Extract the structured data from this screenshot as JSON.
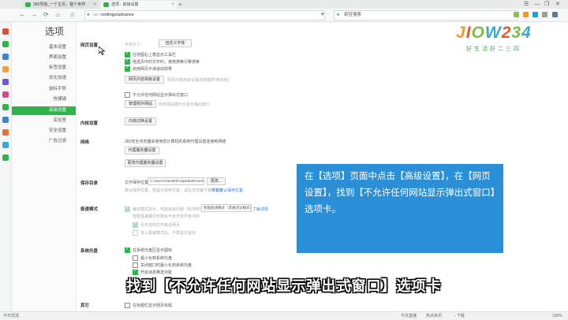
{
  "tabs": [
    {
      "label": "360导航_一个主页，整个世界",
      "icon_color": "#2fb34a"
    },
    {
      "label": "选项 - 高级设置",
      "icon_color": "#2fb34a"
    }
  ],
  "new_tab_label": "+",
  "window_controls": [
    "☰",
    "—",
    "❐",
    "✕"
  ],
  "nav": {
    "back": "←",
    "forward": "→",
    "refresh": "⟳",
    "home": "⌂",
    "star": "☆",
    "address_host": "se://",
    "address_path": "settings/advance",
    "search_text": "疯狂搜索",
    "search_logo": "e"
  },
  "left_strip_icon_colors": [
    "#e24a3a",
    "#2fb34a",
    "#3a86d6",
    "#f0a23a",
    "#6b5bd6",
    "#d64a8a",
    "#2fb34a",
    "#3a86d6",
    "#e2743a",
    "#3aa8d6",
    "#2fb34a"
  ],
  "settings_nav": {
    "title": "选项",
    "items": [
      "基本设置",
      "界面设置",
      "标签设置",
      "优化加速",
      "鼠标手势",
      "快捷键",
      "高级设置",
      "实验室",
      "安全设置",
      "广告过滤"
    ],
    "active_index": 6
  },
  "sections": {
    "web": {
      "label": "网页设置",
      "font_label": "字体大小：",
      "font_button": "自定义字体",
      "checks": [
        "在地图右上角显示工具栏",
        "拖选页中的文字时，使用搜索引擎搜索",
        "启用网页平滑滚动效果"
      ],
      "content_button": "网页内容高级设置",
      "content_note": "网页内容高级设置(控制插件等内容)",
      "popup_check": "不允许任何网站显示弹出式窗口",
      "manage_button": "管理例外网站",
      "manage_note": "所有网站都允许显示弹出窗口"
    },
    "switch": {
      "label": "内核设置",
      "button": "内核切换设置"
    },
    "network": {
      "label": "网络",
      "desc": "360安全浏览器会使用您计算机的系统代理设置连接到网络",
      "proxy_button": "代理服务器设置",
      "change_proxy_button": "更改代理服务器设置"
    },
    "download": {
      "label": "保存目录",
      "path_label": "文件保存位置：",
      "path_value": "C:\\Users\\Xiao900\\AppData\\Roaming\\360se6",
      "change_button": "更改...",
      "note": "默认保存位置，若提示保存位置，请在浏览器下载中设置",
      "link": "恢复默认保存位置"
    },
    "compat": {
      "label": "极速模式",
      "check": "兼容模式显示，可能会有问题（检测地址）",
      "select_value": "智能极速模式（普通浏览模式）",
      "link": "了解详情",
      "note": "智能极速模式可能会与安全软件有冲突",
      "sub_checks": [
        "允许自动打开最近网页",
        "进入极速模式后，不再显示提示"
      ]
    },
    "tray": {
      "label": "系统托盘",
      "check": "在系统托盘区显示图标",
      "sub_checks": [
        "最小化到系统托盘",
        "关闭窗口时最小化到系统托盘",
        "开启消息推送功能"
      ]
    },
    "other": {
      "label": "其它",
      "check": "在标题栏显示网页标题"
    }
  },
  "brand": {
    "word": "JIOW234",
    "sub": "好生活好二三四",
    "colors": [
      "#f29a2e",
      "#e9572f",
      "#7bbf3a",
      "#3aa8d6",
      "#e9572f",
      "#7bbf3a",
      "#3aa8d6"
    ]
  },
  "tip": "在【选项】页面中点击【高级设置】，在【网页设置】，找到【不允许任何网站显示弹出式窗口】选项卡。",
  "subtitle": "找到【不允许任何网站显示弹出式窗口】选项卡",
  "status": {
    "left": "今日优选",
    "right_items": [
      "今日直播",
      "热点资讯",
      "↓ 下载",
      "100%"
    ]
  }
}
